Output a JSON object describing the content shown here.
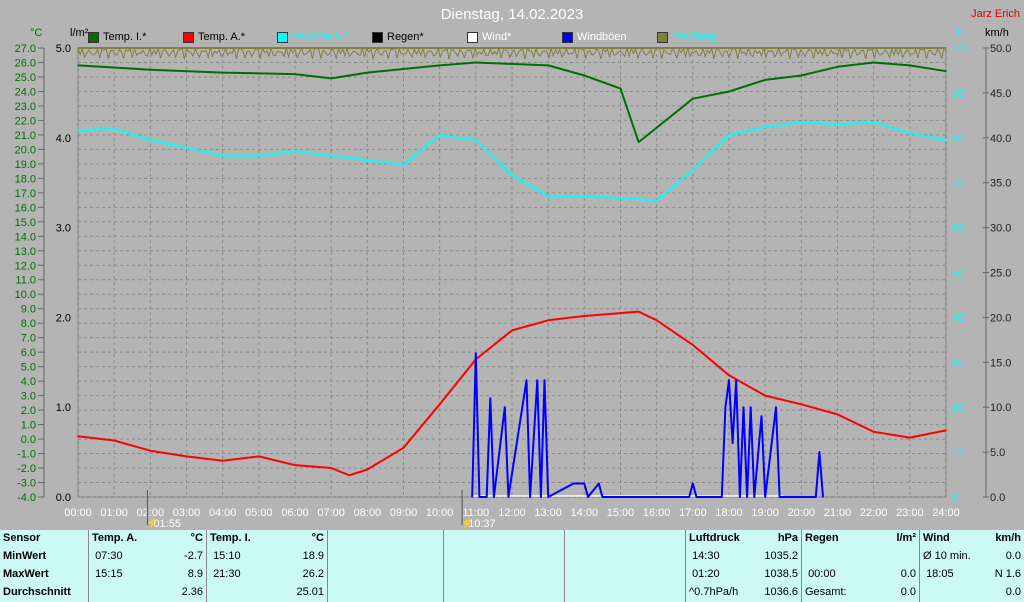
{
  "header": {
    "title": "Dienstag, 14.02.2023",
    "author": "Jarz Erich"
  },
  "axes": {
    "left1_unit": "°C",
    "left2_unit": "l/m²",
    "right1_unit": "%",
    "right2_unit": "km/h"
  },
  "chart_data": {
    "type": "line",
    "title": "Dienstag, 14.02.2023",
    "x_ticks": [
      "00:00",
      "01:00",
      "02:00",
      "03:00",
      "04:00",
      "05:00",
      "06:00",
      "07:00",
      "08:00",
      "09:00",
      "10:00",
      "11:00",
      "12:00",
      "13:00",
      "14:00",
      "15:00",
      "16:00",
      "17:00",
      "18:00",
      "19:00",
      "20:00",
      "21:00",
      "22:00",
      "23:00",
      "24:00"
    ],
    "xlim": [
      0,
      24
    ],
    "temp_axis": {
      "range": [
        -4,
        27
      ],
      "unit": "°C"
    },
    "rain_axis": {
      "range": [
        0,
        5
      ],
      "ticks": [
        "0.0",
        "1.0",
        "2.0",
        "3.0",
        "4.0",
        "5.0"
      ],
      "unit": "l/m²"
    },
    "hum_axis": {
      "range": [
        0,
        100
      ],
      "ticks": [
        "0",
        "10",
        "20",
        "30",
        "40",
        "50",
        "60",
        "70",
        "80",
        "90",
        "100"
      ],
      "unit": "%"
    },
    "wind_axis": {
      "range": [
        0,
        50
      ],
      "ticks": [
        "0.0",
        "5.0",
        "10.0",
        "15.0",
        "20.0",
        "25.0",
        "30.0",
        "35.0",
        "40.0",
        "45.0",
        "50.0"
      ],
      "unit": "km/h"
    },
    "legend": [
      {
        "name": "Temp. I.*",
        "color": "#007000",
        "label_color": "#000000"
      },
      {
        "name": "Temp. A.*",
        "color": "#ff0000",
        "label_color": "#000000"
      },
      {
        "name": "Feuchte A.*",
        "color": "#00ffff",
        "label_color": "#00ffff"
      },
      {
        "name": "Regen*",
        "color": "#000000",
        "label_color": "#000000"
      },
      {
        "name": "Wind*",
        "color": "#ffffff",
        "label_color": "#ffffff"
      },
      {
        "name": "Windböen",
        "color": "#0000ff",
        "label_color": "#ffffff"
      },
      {
        "name": "Empfang",
        "color": "#808040",
        "label_color": "#00ffff"
      }
    ],
    "series": [
      {
        "name": "Temp. I.",
        "axis": "temp",
        "color": "#007000",
        "points": [
          [
            0,
            25.8
          ],
          [
            2,
            25.5
          ],
          [
            4,
            25.3
          ],
          [
            6,
            25.2
          ],
          [
            7,
            24.9
          ],
          [
            8,
            25.3
          ],
          [
            10,
            25.8
          ],
          [
            11,
            26.0
          ],
          [
            13,
            25.8
          ],
          [
            14,
            25.1
          ],
          [
            15,
            24.2
          ],
          [
            15.5,
            20.5
          ],
          [
            16,
            21.5
          ],
          [
            17,
            23.5
          ],
          [
            18,
            24.0
          ],
          [
            19,
            24.8
          ],
          [
            20,
            25.1
          ],
          [
            21,
            25.7
          ],
          [
            22,
            26.0
          ],
          [
            23,
            25.8
          ],
          [
            24,
            25.4
          ]
        ]
      },
      {
        "name": "Temp. A.",
        "axis": "temp",
        "color": "#ff0000",
        "points": [
          [
            0,
            0.2
          ],
          [
            1,
            -0.1
          ],
          [
            2,
            -0.8
          ],
          [
            3,
            -1.2
          ],
          [
            4,
            -1.5
          ],
          [
            5,
            -1.2
          ],
          [
            6,
            -1.8
          ],
          [
            7,
            -2.0
          ],
          [
            7.5,
            -2.5
          ],
          [
            8,
            -2.1
          ],
          [
            9,
            -0.6
          ],
          [
            10,
            2.4
          ],
          [
            11,
            5.5
          ],
          [
            12,
            7.5
          ],
          [
            13,
            8.2
          ],
          [
            14,
            8.5
          ],
          [
            15,
            8.7
          ],
          [
            15.5,
            8.8
          ],
          [
            16,
            8.2
          ],
          [
            17,
            6.5
          ],
          [
            18,
            4.4
          ],
          [
            19,
            3.0
          ],
          [
            20,
            2.4
          ],
          [
            21,
            1.7
          ],
          [
            22,
            0.5
          ],
          [
            23,
            0.1
          ],
          [
            24,
            0.6
          ]
        ]
      },
      {
        "name": "Feuchte A.",
        "axis": "hum",
        "color": "#00ffff",
        "points": [
          [
            0,
            81.7
          ],
          [
            1,
            82
          ],
          [
            2,
            79.5
          ],
          [
            4,
            76
          ],
          [
            5,
            76
          ],
          [
            6,
            77
          ],
          [
            8,
            75
          ],
          [
            9,
            74
          ],
          [
            10,
            80.6
          ],
          [
            11,
            79.5
          ],
          [
            12,
            71.7
          ],
          [
            13,
            67
          ],
          [
            14,
            67
          ],
          [
            15,
            66.6
          ],
          [
            16,
            66
          ],
          [
            17,
            72.8
          ],
          [
            18,
            80.6
          ],
          [
            19,
            82.4
          ],
          [
            20,
            83.5
          ],
          [
            21,
            83
          ],
          [
            22,
            83.5
          ],
          [
            23,
            81
          ],
          [
            24,
            79.5
          ]
        ]
      },
      {
        "name": "Windböen",
        "axis": "wind",
        "color": "#0000ff",
        "points": [
          [
            10.9,
            0
          ],
          [
            11.0,
            16
          ],
          [
            11.1,
            0
          ],
          [
            11.3,
            0
          ],
          [
            11.4,
            11
          ],
          [
            11.5,
            0
          ],
          [
            11.8,
            10
          ],
          [
            11.9,
            0
          ],
          [
            12.4,
            13
          ],
          [
            12.5,
            0
          ],
          [
            12.7,
            13
          ],
          [
            12.8,
            0
          ],
          [
            12.9,
            13
          ],
          [
            13.0,
            0
          ],
          [
            13.7,
            1.5
          ],
          [
            14.0,
            1.5
          ],
          [
            14.1,
            0
          ],
          [
            14.4,
            1.5
          ],
          [
            14.5,
            0
          ],
          [
            16.9,
            0
          ],
          [
            17.0,
            1.5
          ],
          [
            17.1,
            0
          ],
          [
            17.8,
            0
          ],
          [
            17.9,
            10
          ],
          [
            18.0,
            13
          ],
          [
            18.1,
            6
          ],
          [
            18.2,
            13
          ],
          [
            18.3,
            0
          ],
          [
            18.4,
            10
          ],
          [
            18.5,
            0
          ],
          [
            18.6,
            10
          ],
          [
            18.7,
            0
          ],
          [
            18.9,
            9
          ],
          [
            19.0,
            0
          ],
          [
            19.3,
            10
          ],
          [
            19.4,
            0
          ],
          [
            20.4,
            0
          ],
          [
            20.5,
            5
          ],
          [
            20.6,
            0
          ]
        ]
      }
    ],
    "markers": [
      {
        "label": "01:55",
        "x": 1.92
      },
      {
        "label": "10:37",
        "x": 10.62
      }
    ]
  },
  "table": {
    "sensor": {
      "header": "Sensor",
      "rows": [
        "MinWert",
        "MaxWert",
        "Durchschnitt"
      ]
    },
    "temp_a": {
      "header": "Temp. A.",
      "unit": "°C",
      "min_time": "07:30",
      "min": "-2.7",
      "max_time": "15:15",
      "max": "8.9",
      "avg": "2.36"
    },
    "temp_i": {
      "header": "Temp. I.",
      "unit": "°C",
      "min_time": "15:10",
      "min": "18.9",
      "max_time": "21:30",
      "max": "26.2",
      "avg": "25.01"
    },
    "pressure": {
      "header": "Luftdruck",
      "unit": "hPa",
      "min_time": "14:30",
      "min": "1035.2",
      "max_time": "01:20",
      "max": "1038.5",
      "trend": "^0.7hPa/h",
      "avg": "1036.6"
    },
    "rain": {
      "header": "Regen",
      "unit": "l/m²",
      "r2_time": "00:00",
      "r2": "0.0",
      "r3_label": "Gesamt:",
      "r3": "0.0"
    },
    "wind": {
      "header": "Wind",
      "unit": "km/h",
      "r1_label": "Ø 10 min.",
      "r1": "0.0",
      "r2_time": "18:05",
      "r2": "N 1.6",
      "r3": "0.0"
    }
  }
}
